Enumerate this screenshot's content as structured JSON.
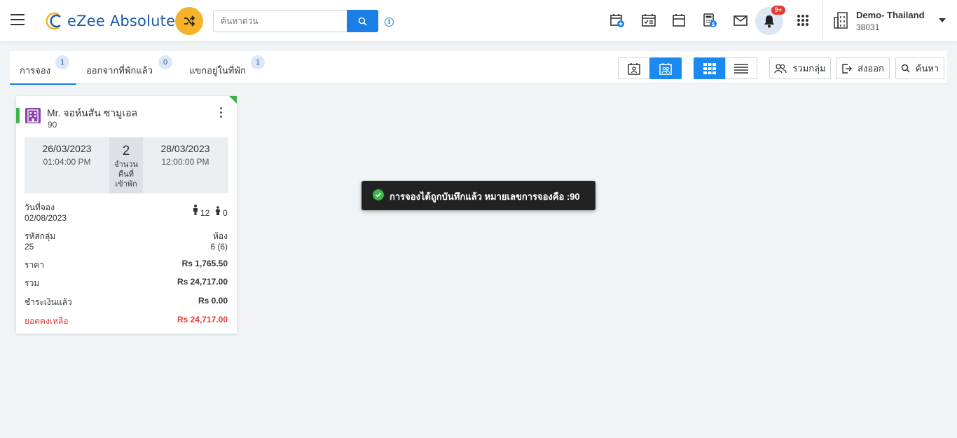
{
  "header": {
    "logo_text": "eZee Absolute",
    "search_placeholder": "ค้นหาด่วน",
    "notification_badge": "9+",
    "hotel_name": "Demo- Thailand",
    "hotel_code": "38031"
  },
  "tabs": [
    {
      "label": "การจอง",
      "count": "1"
    },
    {
      "label": "ออกจากที่พักแล้ว",
      "count": "0"
    },
    {
      "label": "แขกอยู่ในที่พัก",
      "count": "1"
    }
  ],
  "toolbar": {
    "group_label": "รวมกลุ่ม",
    "export_label": "ส่งออก",
    "search_label": "ค้นหา"
  },
  "booking_card": {
    "guest_name": "Mr. จอห์นสัน ซามูเอล",
    "reservation_no": "90",
    "arrival_date": "26/03/2023",
    "arrival_time": "01:04:00 PM",
    "nights": "2",
    "nights_label_1": "จำนวน",
    "nights_label_2": "คืนที่",
    "nights_label_3": "เข้าพัก",
    "departure_date": "28/03/2023",
    "departure_time": "12:00:00 PM",
    "booking_date_label": "วันที่จอง",
    "booking_date": "02/08/2023",
    "adults": "12",
    "children": "0",
    "group_code_label": "รหัสกลุ่ม",
    "group_code": "25",
    "room_label": "ห้อง",
    "room_value": "6 (6)",
    "rate_label": "ราคา",
    "rate_value": "Rs 1,765.50",
    "total_label": "รวม",
    "total_value": "Rs 24,717.00",
    "paid_label": "ชำระเงินแล้ว",
    "paid_value": "Rs 0.00",
    "balance_label": "ยอดคงเหลือ",
    "balance_value": "Rs 24,717.00"
  },
  "toast": {
    "message": "การจองได้ถูกบันทึกแล้ว หมายเลขการจองคือ :90"
  },
  "colors": {
    "primary": "#1a7ee8",
    "accent": "#f5b32a",
    "success": "#39b54a",
    "danger": "#e53935"
  }
}
